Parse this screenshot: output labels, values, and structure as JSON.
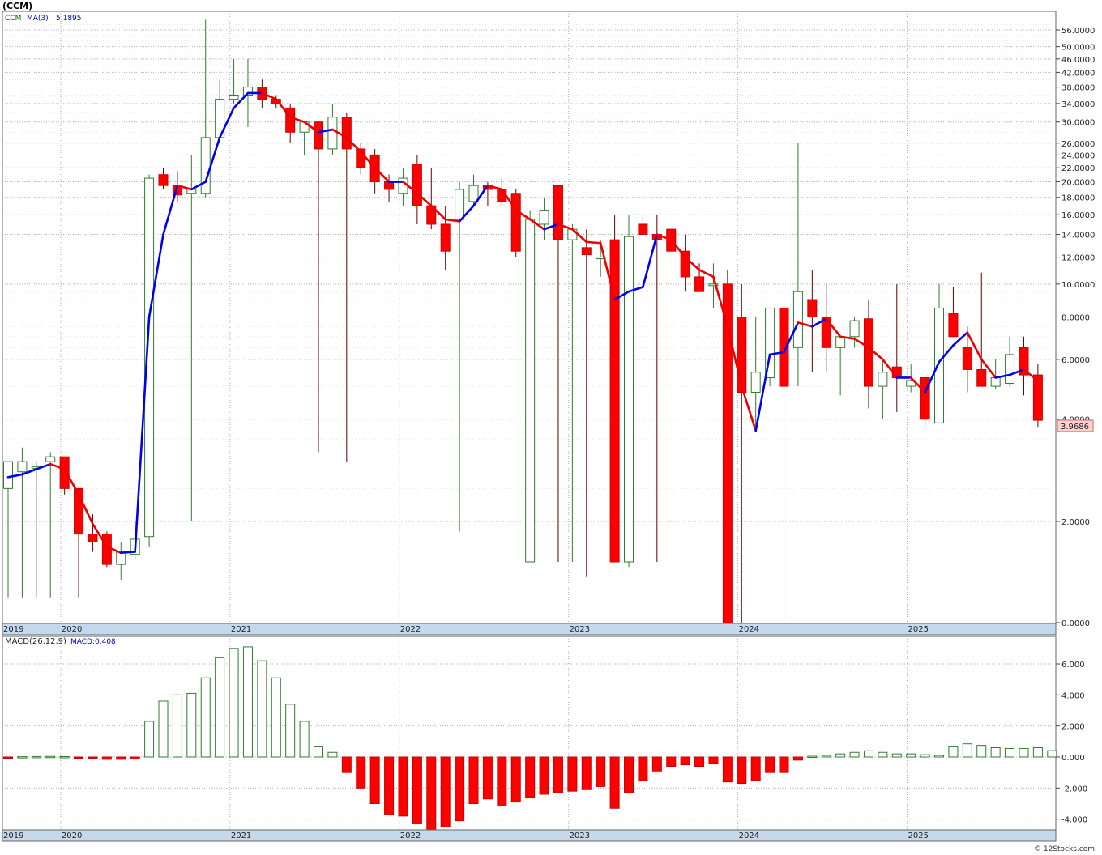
{
  "chart_title": "(CCM)",
  "watermark": "© 12Stocks.com",
  "colors": {
    "up": "#2f7d2f",
    "down": "#ff0000",
    "down_wick": "#660000",
    "ma_up": "#0000ee",
    "ma_down": "#ee0000",
    "grid": "#b0b0b0",
    "axis_bar": "#c5d9ec"
  },
  "chart_data": [
    {
      "type": "candlestick",
      "legend": {
        "symbol": "CCM",
        "ma_label": "MA(3)",
        "ma_value": "5.1895"
      },
      "last_price_label": "3.9686",
      "y_scale": "log",
      "y_ticks": [
        {
          "v": 56,
          "label": "56.0000"
        },
        {
          "v": 50,
          "label": "50.0000"
        },
        {
          "v": 46,
          "label": "46.0000"
        },
        {
          "v": 42,
          "label": "42.0000"
        },
        {
          "v": 38,
          "label": "38.0000"
        },
        {
          "v": 34,
          "label": "34.0000"
        },
        {
          "v": 30,
          "label": "30.0000"
        },
        {
          "v": 26,
          "label": "26.0000"
        },
        {
          "v": 24,
          "label": "24.0000"
        },
        {
          "v": 22,
          "label": "22.0000"
        },
        {
          "v": 20,
          "label": "20.0000"
        },
        {
          "v": 18,
          "label": "18.0000"
        },
        {
          "v": 16,
          "label": "16.0000"
        },
        {
          "v": 14,
          "label": "14.0000"
        },
        {
          "v": 12,
          "label": "12.0000"
        },
        {
          "v": 10,
          "label": "10.0000"
        },
        {
          "v": 8,
          "label": "8.0000"
        },
        {
          "v": 6,
          "label": "6.0000"
        },
        {
          "v": 4,
          "label": "4.0000"
        },
        {
          "v": 2,
          "label": "2.0000"
        },
        {
          "v": 0,
          "label": "0.0000"
        }
      ],
      "x_labels": [
        "2019",
        "2020",
        "2021",
        "2022",
        "2023",
        "2024",
        "2025"
      ],
      "candles": [
        {
          "o": 2.5,
          "h": 3.0,
          "l": 0.5,
          "c": 3.0
        },
        {
          "o": 2.8,
          "h": 3.3,
          "l": 0.5,
          "c": 3.0
        },
        {
          "o": 2.9,
          "h": 3.0,
          "l": 0.5,
          "c": 2.9
        },
        {
          "o": 3.0,
          "h": 3.2,
          "l": 0.5,
          "c": 3.1
        },
        {
          "o": 3.1,
          "h": 3.1,
          "l": 2.4,
          "c": 2.5
        },
        {
          "o": 2.5,
          "h": 2.5,
          "l": 0.5,
          "c": 1.75
        },
        {
          "o": 1.75,
          "h": 2.1,
          "l": 1.4,
          "c": 1.6
        },
        {
          "o": 1.75,
          "h": 1.8,
          "l": 1.1,
          "c": 1.15
        },
        {
          "o": 1.15,
          "h": 1.6,
          "l": 0.85,
          "c": 1.4
        },
        {
          "o": 1.35,
          "h": 2.0,
          "l": 1.25,
          "c": 1.65
        },
        {
          "o": 1.7,
          "h": 21.0,
          "l": 1.5,
          "c": 20.5
        },
        {
          "o": 21.0,
          "h": 22.0,
          "l": 19.0,
          "c": 19.5
        },
        {
          "o": 19.5,
          "h": 21.5,
          "l": 17.5,
          "c": 18.3
        },
        {
          "o": 18.5,
          "h": 24.0,
          "l": 2.0,
          "c": 19.0
        },
        {
          "o": 18.5,
          "h": 60.0,
          "l": 18.0,
          "c": 27.0
        },
        {
          "o": 27.0,
          "h": 40.0,
          "l": 26.0,
          "c": 35.0
        },
        {
          "o": 35.0,
          "h": 46.0,
          "l": 34.0,
          "c": 36.0
        },
        {
          "o": 36.0,
          "h": 46.0,
          "l": 29.0,
          "c": 38.0
        },
        {
          "o": 38.0,
          "h": 40.0,
          "l": 33.0,
          "c": 35.0
        },
        {
          "o": 35.0,
          "h": 36.0,
          "l": 33.0,
          "c": 34.0
        },
        {
          "o": 33.0,
          "h": 34.0,
          "l": 26.0,
          "c": 28.0
        },
        {
          "o": 28.0,
          "h": 30.0,
          "l": 24.0,
          "c": 30.0
        },
        {
          "o": 30.0,
          "h": 30.0,
          "l": 3.2,
          "c": 25.0
        },
        {
          "o": 25.0,
          "h": 34.0,
          "l": 24.0,
          "c": 31.0
        },
        {
          "o": 31.0,
          "h": 32.0,
          "l": 3.0,
          "c": 25.0
        },
        {
          "o": 25.0,
          "h": 26.0,
          "l": 21.0,
          "c": 22.0
        },
        {
          "o": 24.0,
          "h": 25.0,
          "l": 18.5,
          "c": 20.0
        },
        {
          "o": 20.0,
          "h": 21.0,
          "l": 17.5,
          "c": 19.0
        },
        {
          "o": 18.5,
          "h": 22.0,
          "l": 17.0,
          "c": 20.5
        },
        {
          "o": 22.5,
          "h": 24.0,
          "l": 15.0,
          "c": 17.0
        },
        {
          "o": 17.0,
          "h": 22.0,
          "l": 14.5,
          "c": 15.0
        },
        {
          "o": 15.0,
          "h": 17.0,
          "l": 11.0,
          "c": 12.5
        },
        {
          "o": 15.5,
          "h": 20.0,
          "l": 1.8,
          "c": 19.0
        },
        {
          "o": 17.5,
          "h": 21.0,
          "l": 17.0,
          "c": 19.5
        },
        {
          "o": 19.5,
          "h": 20.0,
          "l": 17.0,
          "c": 19.0
        },
        {
          "o": 19.0,
          "h": 20.5,
          "l": 17.0,
          "c": 17.5
        },
        {
          "o": 18.5,
          "h": 19.0,
          "l": 12.0,
          "c": 12.5
        },
        {
          "o": 1.2,
          "h": 16.5,
          "l": 1.2,
          "c": 15.5
        },
        {
          "o": 15.0,
          "h": 18.0,
          "l": 13.5,
          "c": 16.5
        },
        {
          "o": 19.5,
          "h": 19.5,
          "l": 1.2,
          "c": 13.5
        },
        {
          "o": 13.5,
          "h": 15.0,
          "l": 1.2,
          "c": 14.5
        },
        {
          "o": 12.8,
          "h": 14.5,
          "l": 0.9,
          "c": 12.2
        },
        {
          "o": 12.0,
          "h": 13.5,
          "l": 10.5,
          "c": 12.0
        },
        {
          "o": 13.5,
          "h": 16.0,
          "l": 1.2,
          "c": 1.2
        },
        {
          "o": 1.2,
          "h": 16.0,
          "l": 1.1,
          "c": 13.8
        },
        {
          "o": 15.0,
          "h": 16.0,
          "l": 14.0,
          "c": 14.0
        },
        {
          "o": 14.0,
          "h": 16.0,
          "l": 1.2,
          "c": 13.5
        },
        {
          "o": 14.5,
          "h": 14.5,
          "l": 12.5,
          "c": 12.5
        },
        {
          "o": 12.5,
          "h": 14.0,
          "l": 9.5,
          "c": 10.5
        },
        {
          "o": 10.5,
          "h": 11.5,
          "l": 9.5,
          "c": 9.5
        },
        {
          "o": 10.0,
          "h": 11.5,
          "l": 8.5,
          "c": 10.0
        },
        {
          "o": 10.0,
          "h": 11.0,
          "l": 0.01,
          "c": 0.01
        },
        {
          "o": 8.0,
          "h": 10.0,
          "l": 0.01,
          "c": 4.8
        },
        {
          "o": 4.8,
          "h": 8.0,
          "l": 3.7,
          "c": 5.5
        },
        {
          "o": 5.3,
          "h": 8.5,
          "l": 5.0,
          "c": 8.5
        },
        {
          "o": 8.5,
          "h": 8.5,
          "l": 0.01,
          "c": 5.0
        },
        {
          "o": 6.5,
          "h": 26.0,
          "l": 5.0,
          "c": 9.5
        },
        {
          "o": 9.0,
          "h": 11.0,
          "l": 5.5,
          "c": 8.0
        },
        {
          "o": 8.0,
          "h": 10.0,
          "l": 5.5,
          "c": 6.5
        },
        {
          "o": 6.5,
          "h": 7.0,
          "l": 4.7,
          "c": 7.0
        },
        {
          "o": 7.0,
          "h": 8.0,
          "l": 6.5,
          "c": 7.8
        },
        {
          "o": 7.9,
          "h": 9.0,
          "l": 4.3,
          "c": 5.0
        },
        {
          "o": 5.0,
          "h": 6.0,
          "l": 4.0,
          "c": 5.5
        },
        {
          "o": 5.7,
          "h": 10.0,
          "l": 4.2,
          "c": 5.3
        },
        {
          "o": 5.0,
          "h": 5.8,
          "l": 4.8,
          "c": 5.2
        },
        {
          "o": 5.3,
          "h": 5.3,
          "l": 3.8,
          "c": 4.0
        },
        {
          "o": 3.9,
          "h": 10.0,
          "l": 3.9,
          "c": 8.5
        },
        {
          "o": 8.2,
          "h": 9.8,
          "l": 7.0,
          "c": 7.0
        },
        {
          "o": 6.5,
          "h": 7.5,
          "l": 4.8,
          "c": 5.6
        },
        {
          "o": 5.6,
          "h": 10.8,
          "l": 5.0,
          "c": 5.0
        },
        {
          "o": 5.0,
          "h": 6.0,
          "l": 4.9,
          "c": 5.3
        },
        {
          "o": 5.1,
          "h": 7.0,
          "l": 5.0,
          "c": 6.2
        },
        {
          "o": 6.5,
          "h": 7.0,
          "l": 4.7,
          "c": 5.4
        },
        {
          "o": 5.4,
          "h": 5.8,
          "l": 3.8,
          "c": 3.97
        }
      ],
      "ma3": [
        2.7,
        2.75,
        2.85,
        2.95,
        2.85,
        2.4,
        1.95,
        1.5,
        1.38,
        1.4,
        8.0,
        14.0,
        19.5,
        19.0,
        20.0,
        27.0,
        33.0,
        36.5,
        36.5,
        35.0,
        31.0,
        30.0,
        28.0,
        28.5,
        27.0,
        24.5,
        22.0,
        20.0,
        20.0,
        18.5,
        17.0,
        15.5,
        15.3,
        17.0,
        19.5,
        19.0,
        16.5,
        15.5,
        14.5,
        15.0,
        14.5,
        13.3,
        13.2,
        9.0,
        9.5,
        9.8,
        14.0,
        13.5,
        12.0,
        11.0,
        10.5,
        7.5,
        5.0,
        3.7,
        6.2,
        6.3,
        7.7,
        7.5,
        7.9,
        7.0,
        6.9,
        6.5,
        6.0,
        5.3,
        5.3,
        4.8,
        5.9,
        6.6,
        7.2,
        6.0,
        5.3,
        5.4,
        5.6,
        5.19
      ]
    },
    {
      "type": "bar",
      "legend": {
        "label": "MACD(26,12,9)",
        "value_label": "MACD:0.408"
      },
      "y_ticks": [
        {
          "v": 6,
          "label": "6.000"
        },
        {
          "v": 4,
          "label": "4.000"
        },
        {
          "v": 2,
          "label": "2.000"
        },
        {
          "v": 0,
          "label": "0.000"
        },
        {
          "v": -2,
          "label": "-2.000"
        },
        {
          "v": -4,
          "label": "-4.000"
        }
      ],
      "x_labels": [
        "2019",
        "2020",
        "2021",
        "2022",
        "2023",
        "2024",
        "2025"
      ],
      "values": [
        -0.02,
        0.02,
        0.03,
        0.04,
        0.03,
        -0.05,
        -0.1,
        -0.15,
        -0.15,
        -0.12,
        2.3,
        3.6,
        4.0,
        4.1,
        5.1,
        6.4,
        7.0,
        7.1,
        6.2,
        5.1,
        3.4,
        2.3,
        0.7,
        0.3,
        -1.0,
        -2.0,
        -3.0,
        -3.7,
        -3.8,
        -4.3,
        -4.7,
        -4.5,
        -4.1,
        -3.0,
        -2.7,
        -3.1,
        -2.9,
        -2.6,
        -2.4,
        -2.3,
        -2.2,
        -2.1,
        -1.9,
        -3.3,
        -2.3,
        -1.5,
        -0.9,
        -0.6,
        -0.5,
        -0.6,
        -0.4,
        -1.6,
        -1.7,
        -1.5,
        -1.0,
        -1.0,
        -0.2,
        0.05,
        0.1,
        0.2,
        0.3,
        0.4,
        0.3,
        0.2,
        0.2,
        0.15,
        0.1,
        0.7,
        0.85,
        0.75,
        0.6,
        0.55,
        0.55,
        0.6,
        0.408
      ]
    }
  ]
}
